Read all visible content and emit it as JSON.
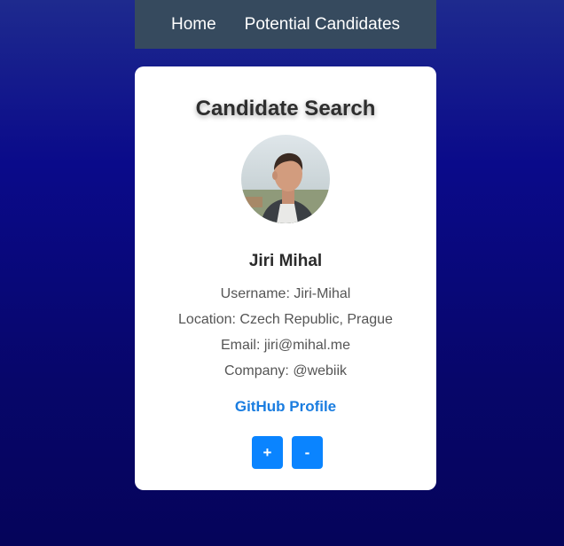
{
  "nav": {
    "home_label": "Home",
    "candidates_label": "Potential Candidates"
  },
  "card": {
    "title": "Candidate Search",
    "avatar_icon": "profile-photo",
    "name": "Jiri Mihal",
    "username": "Username: Jiri-Mihal",
    "location": "Location: Czech Republic, Prague",
    "email": "Email: jiri@mihal.me",
    "company": "Company: @webiik",
    "profile_link": "GitHub Profile",
    "add_label": "+",
    "reject_label": "-"
  },
  "colors": {
    "nav_bg": "#364a5e",
    "button": "#0a84ff",
    "link": "#1a7de0"
  }
}
